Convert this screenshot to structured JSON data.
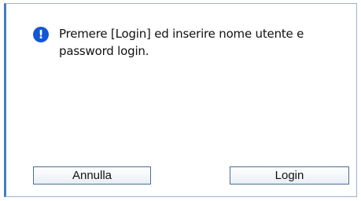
{
  "dialog": {
    "icon": "exclamation-info-icon",
    "icon_glyph": "!",
    "message": "Premere [Login] ed inserire nome utente e password login.",
    "buttons": {
      "cancel_label": "Annulla",
      "login_label": "Login"
    },
    "colors": {
      "icon_bg": "#1457d6",
      "border_accent": "#3f7fbf"
    }
  }
}
